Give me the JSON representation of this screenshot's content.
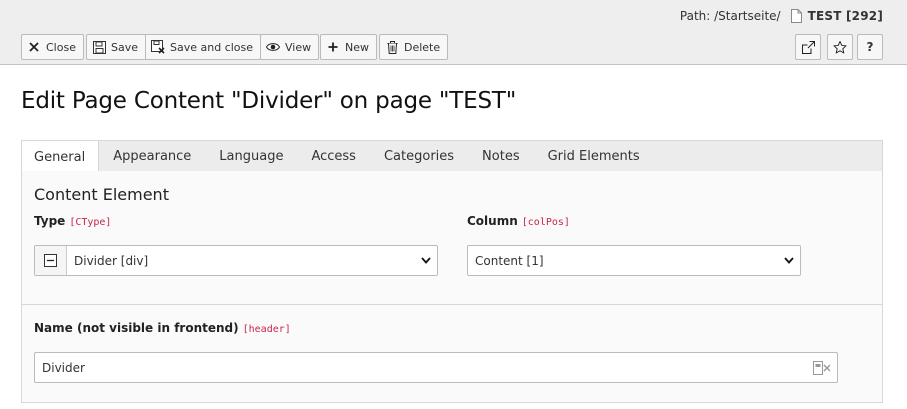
{
  "path": {
    "label": "Path: /Startseite/",
    "page": "TEST [292]"
  },
  "toolbar": {
    "close": "Close",
    "save": "Save",
    "save_close": "Save and close",
    "view": "View",
    "new": "New",
    "delete": "Delete",
    "right_icons": [
      "open-new-window-icon",
      "star-icon",
      "help-icon"
    ],
    "help_label": "?"
  },
  "heading": "Edit Page Content \"Divider\" on page \"TEST\"",
  "tabs": [
    {
      "label": "General",
      "active": true
    },
    {
      "label": "Appearance",
      "active": false
    },
    {
      "label": "Language",
      "active": false
    },
    {
      "label": "Access",
      "active": false
    },
    {
      "label": "Categories",
      "active": false
    },
    {
      "label": "Notes",
      "active": false
    },
    {
      "label": "Grid Elements",
      "active": false
    }
  ],
  "form": {
    "section_title": "Content Element",
    "type": {
      "label": "Type",
      "code": "[CType]",
      "value": "Divider [div]"
    },
    "column": {
      "label": "Column",
      "code": "[colPos]",
      "value": "Content [1]"
    },
    "name": {
      "label": "Name (not visible in frontend)",
      "code": "[header]",
      "value": "Divider"
    }
  },
  "colors": {
    "accent_code": "#c7254e",
    "toolbar_bg": "#eeeeee"
  }
}
